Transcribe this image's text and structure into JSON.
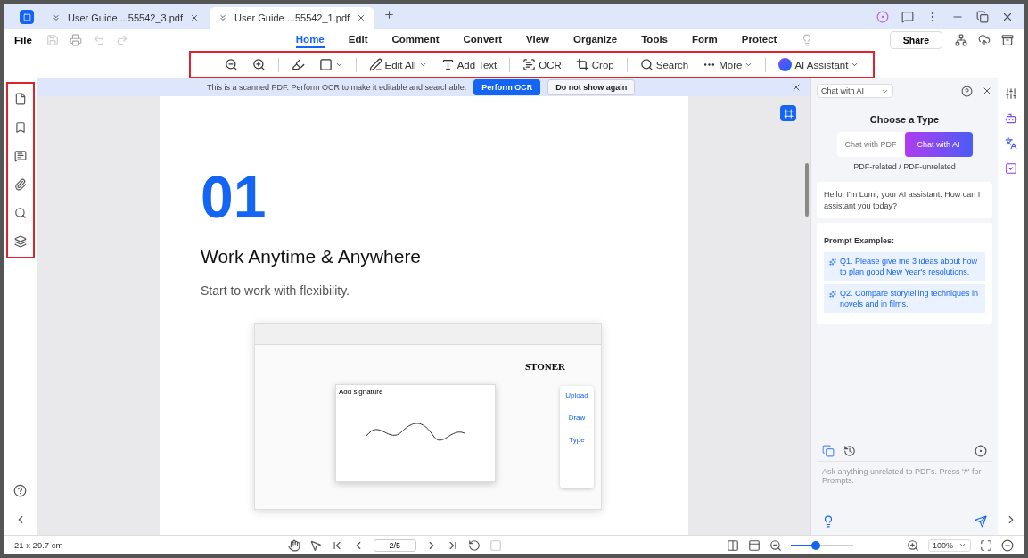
{
  "tabs": [
    {
      "label": "User Guide ...55542_3.pdf",
      "selected": false
    },
    {
      "label": "User Guide ...55542_1.pdf",
      "selected": true
    }
  ],
  "menu": {
    "file": "File",
    "items": [
      {
        "label": "Home",
        "selected": true
      },
      {
        "label": "Edit",
        "selected": false
      },
      {
        "label": "Comment",
        "selected": false
      },
      {
        "label": "Convert",
        "selected": false
      },
      {
        "label": "View",
        "selected": false
      },
      {
        "label": "Organize",
        "selected": false
      },
      {
        "label": "Tools",
        "selected": false
      },
      {
        "label": "Form",
        "selected": false
      },
      {
        "label": "Protect",
        "selected": false
      }
    ],
    "share": "Share"
  },
  "toolbar": [
    {
      "kind": "icon"
    },
    {
      "kind": "icon"
    },
    {
      "kind": "sep"
    },
    {
      "kind": "icon"
    },
    {
      "kind": "icon",
      "dropdown": true
    },
    {
      "kind": "sep"
    },
    {
      "kind": "text",
      "label": "Edit All",
      "dropdown": true
    },
    {
      "kind": "text",
      "label": "Add Text"
    },
    {
      "kind": "sep"
    },
    {
      "kind": "text",
      "label": "OCR"
    },
    {
      "kind": "text",
      "label": "Crop"
    },
    {
      "kind": "sep"
    },
    {
      "kind": "text",
      "label": "Search"
    },
    {
      "kind": "text",
      "label": "More",
      "dropdown": true
    },
    {
      "kind": "sep"
    },
    {
      "kind": "text",
      "label": "AI Assistant",
      "dropdown": true
    }
  ],
  "banner": {
    "message": "This is a scanned PDF. Perform OCR to make it editable and searchable.",
    "primary": "Perform OCR",
    "secondary": "Do not show again"
  },
  "page": {
    "number": "01",
    "title": "Work Anytime & Anywhere",
    "subtitle": "Start to work with flexibility.",
    "inset": {
      "brand": "STONER",
      "dialog": "Add signature",
      "options": [
        "Upload",
        "Draw",
        "Type"
      ]
    }
  },
  "ai_panel": {
    "mode": "Chat with AI",
    "heading": "Choose a Type",
    "types": [
      {
        "label": "Chat with PDF",
        "selected": false
      },
      {
        "label": "Chat with AI",
        "selected": true
      }
    ],
    "caption": "PDF-related / PDF-unrelated",
    "greeting": "Hello, I'm Lumi, your AI assistant. How can I assistant you today?",
    "examples_title": "Prompt Examples:",
    "examples": [
      "Q1. Please give me 3 ideas about how to plan good New Year's resolutions.",
      "Q2. Compare storytelling techniques in novels and in films."
    ],
    "placeholder": "Ask anything unrelated to PDFs. Press '#' for Prompts."
  },
  "status_bar": {
    "page_size": "21 x 29.7 cm",
    "page_field": "2/5",
    "zoom": {
      "value": "100%",
      "level": 0.4
    }
  }
}
